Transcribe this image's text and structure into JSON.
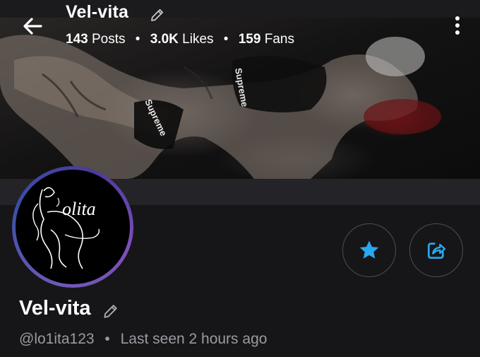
{
  "header": {
    "title": "Vel-vita",
    "stats": [
      {
        "value": "143",
        "label": "Posts"
      },
      {
        "value": "3.0K",
        "label": "Likes"
      },
      {
        "value": "159",
        "label": "Fans"
      }
    ],
    "separator": "•"
  },
  "cover": {
    "brand_text_1": "Supreme",
    "brand_text_2": "Supreme"
  },
  "avatar": {
    "logo_text": "olita"
  },
  "profile": {
    "name": "Vel-vita",
    "handle": "@lo1ita123",
    "separator": "•",
    "last_seen": "Last seen 2 hours ago"
  },
  "colors": {
    "accent": "#29a8f0",
    "background": "#161619",
    "muted_text": "#9a9aa2"
  },
  "icons": {
    "back": "arrow-left-icon",
    "edit": "pencil-icon",
    "more": "more-vertical-icon",
    "favorite": "star-icon",
    "share": "share-icon"
  }
}
